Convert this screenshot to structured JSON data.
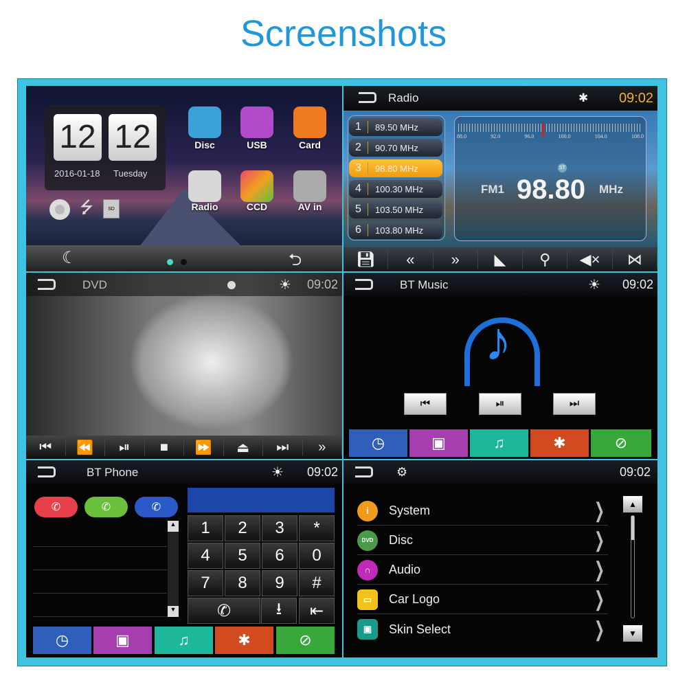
{
  "title": "Screenshots",
  "home": {
    "clock_hour": "12",
    "clock_min": "12",
    "date": "2016-01-18",
    "weekday": "Tuesday",
    "apps": [
      {
        "label": "Disc",
        "color": "#3aa2d8"
      },
      {
        "label": "USB",
        "color": "#b04ac8"
      },
      {
        "label": "Card",
        "color": "#f07a20"
      },
      {
        "label": "Radio",
        "color": "#d8d8d8"
      },
      {
        "label": "CCD",
        "color": "#e84a6a"
      },
      {
        "label": "AV in",
        "color": "#aaaaaa"
      }
    ]
  },
  "radio": {
    "title": "Radio",
    "time": "09:02",
    "band": "FM1",
    "frequency": "98.80",
    "unit": "MHz",
    "stereo": "ST",
    "presets": [
      {
        "n": "1",
        "f": "89.50  MHz"
      },
      {
        "n": "2",
        "f": "90.70  MHz"
      },
      {
        "n": "3",
        "f": "98.80  MHz"
      },
      {
        "n": "4",
        "f": "100.30  MHz"
      },
      {
        "n": "5",
        "f": "103.50  MHz"
      },
      {
        "n": "6",
        "f": "103.80  MHz"
      }
    ],
    "selected_preset": 3,
    "scale": [
      "88.0",
      "92.0",
      "96.0",
      "100.0",
      "104.0",
      "108.0"
    ]
  },
  "dvd": {
    "title": "DVD",
    "time": "09:02"
  },
  "bt_music": {
    "title": "BT Music",
    "time": "09:02"
  },
  "bt_phone": {
    "title": "BT Phone",
    "time": "09:02",
    "keys": [
      "1",
      "2",
      "3",
      "*",
      "4",
      "5",
      "6",
      "0",
      "7",
      "8",
      "9",
      "#"
    ]
  },
  "settings": {
    "time": "09:02",
    "items": [
      "System",
      "Disc",
      "Audio",
      "Car Logo",
      "Skin Select"
    ],
    "dvd_badge": "DVD"
  },
  "tile_colors": [
    "#2f5fba",
    "#a53fb0",
    "#1db89c",
    "#d24a20",
    "#39a83a"
  ]
}
